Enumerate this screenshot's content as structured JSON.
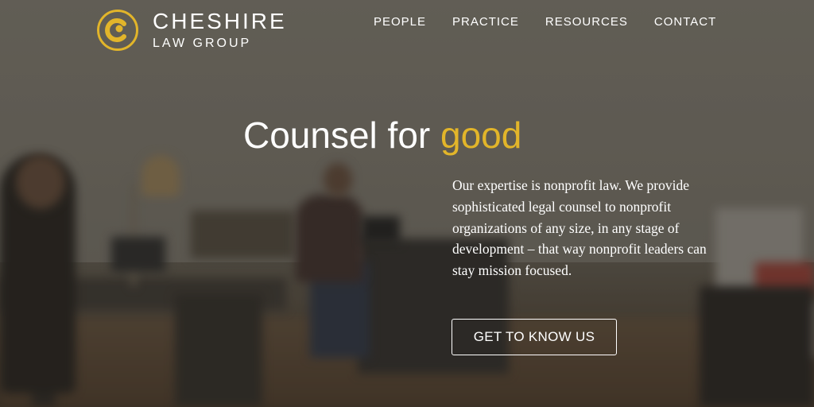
{
  "brand": {
    "name": "CHESHIRE",
    "tagline": "LAW GROUP",
    "logo_icon": "cheshire-c-logo-icon",
    "accent_color": "#e2b52a"
  },
  "nav": {
    "items": [
      {
        "label": "PEOPLE"
      },
      {
        "label": "PRACTICE"
      },
      {
        "label": "RESOURCES"
      },
      {
        "label": "CONTACT"
      }
    ]
  },
  "hero": {
    "headline_prefix": "Counsel for",
    "headline_accent": "good",
    "description": "Our expertise is nonprofit law. We provide sophisticated legal counsel to nonprofit organizations of any size, in any stage of development – that way nonprofit leaders can stay mission focused.",
    "cta_label": "GET TO KNOW US"
  }
}
